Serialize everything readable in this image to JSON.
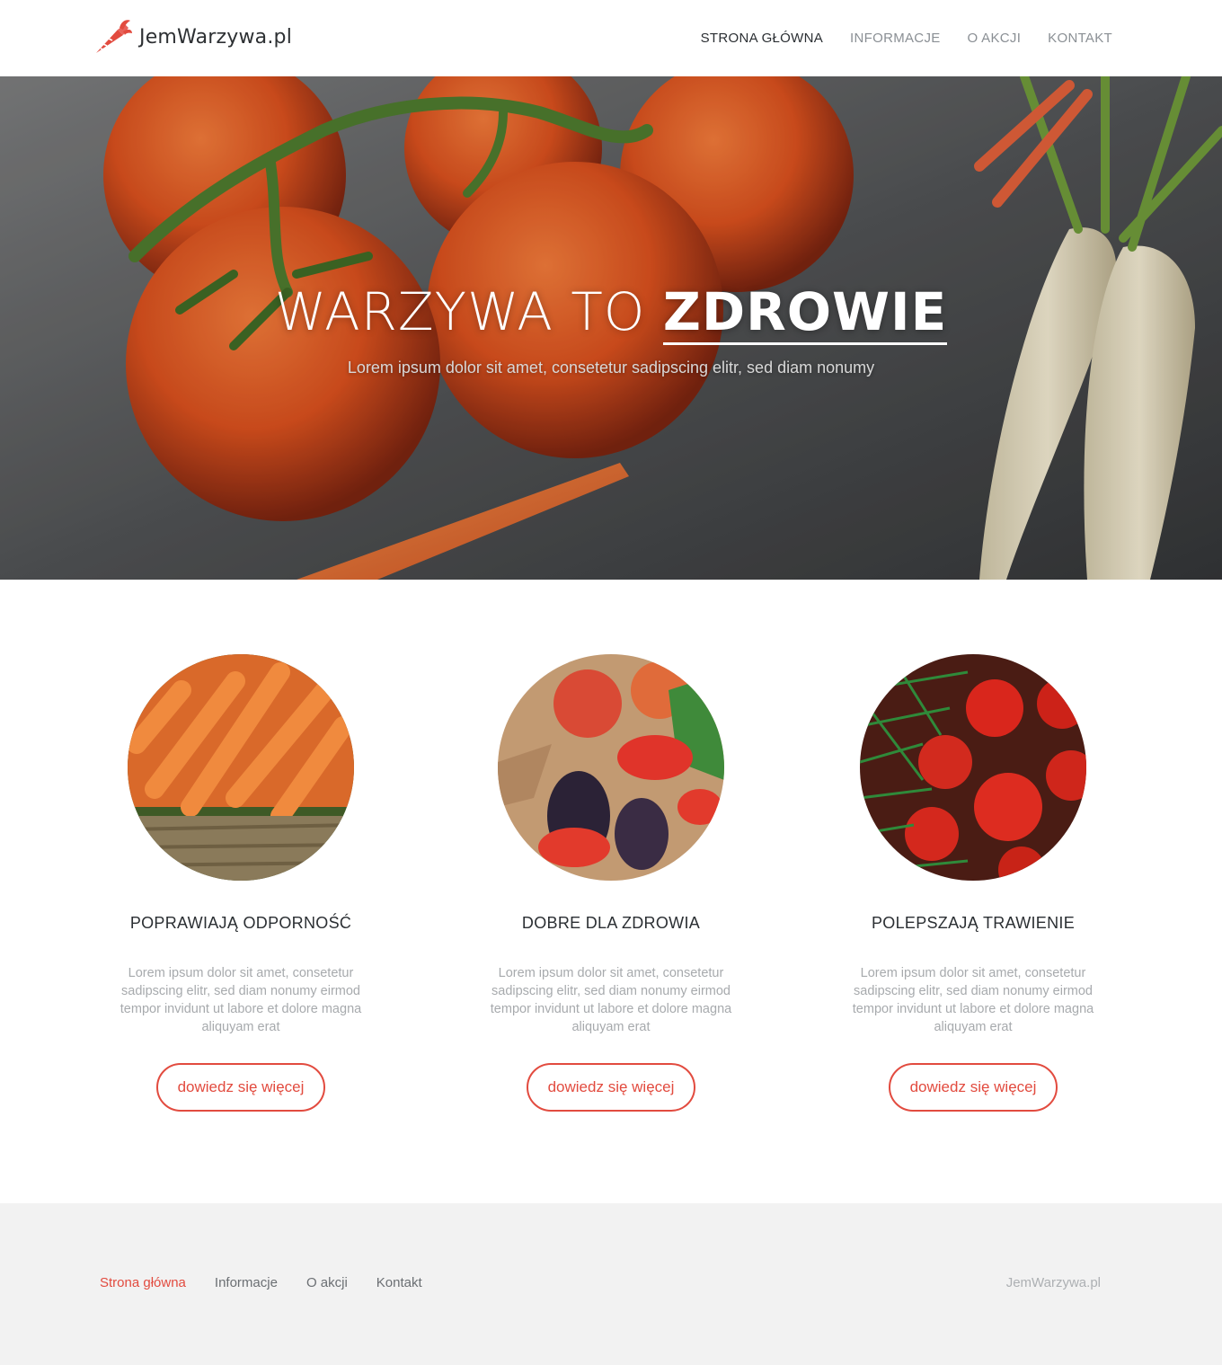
{
  "brand": {
    "name": "JemWarzywa.pl",
    "accent_color": "#e24b3f",
    "logo_icon": "carrot-icon"
  },
  "nav": {
    "items": [
      {
        "label": "STRONA GŁÓWNA",
        "active": true
      },
      {
        "label": "INFORMACJE",
        "active": false
      },
      {
        "label": "O AKCJI",
        "active": false
      },
      {
        "label": "KONTAKT",
        "active": false
      }
    ]
  },
  "hero": {
    "title_light": "WARZYWA TO ",
    "title_bold": "ZDROWIE",
    "subtitle": "Lorem ipsum dolor sit amet, consetetur sadipscing elitr, sed diam nonumy"
  },
  "features": [
    {
      "image": "carrots-basket-photo",
      "title": "POPRAWIAJĄ ODPORNOŚĆ",
      "text": "Lorem ipsum dolor sit amet, consetetur sadipscing elitr, sed diam nonumy eirmod tempor invidunt ut labore et dolore magna aliquyam erat",
      "button": "dowiedz się więcej"
    },
    {
      "image": "vegetables-paper-bags-photo",
      "title": "DOBRE DLA ZDROWIA",
      "text": "Lorem ipsum dolor sit amet, consetetur sadipscing elitr, sed diam nonumy eirmod tempor invidunt ut labore et dolore magna aliquyam erat",
      "button": "dowiedz się więcej"
    },
    {
      "image": "tomatoes-dill-photo",
      "title": "POLEPSZAJĄ TRAWIENIE",
      "text": "Lorem ipsum dolor sit amet, consetetur sadipscing elitr, sed diam nonumy eirmod tempor invidunt ut labore et dolore magna aliquyam erat",
      "button": "dowiedz się więcej"
    }
  ],
  "footer": {
    "links": [
      {
        "label": "Strona główna",
        "active": true
      },
      {
        "label": "Informacje",
        "active": false
      },
      {
        "label": "O akcji",
        "active": false
      },
      {
        "label": "Kontakt",
        "active": false
      }
    ],
    "brand": "JemWarzywa.pl"
  }
}
